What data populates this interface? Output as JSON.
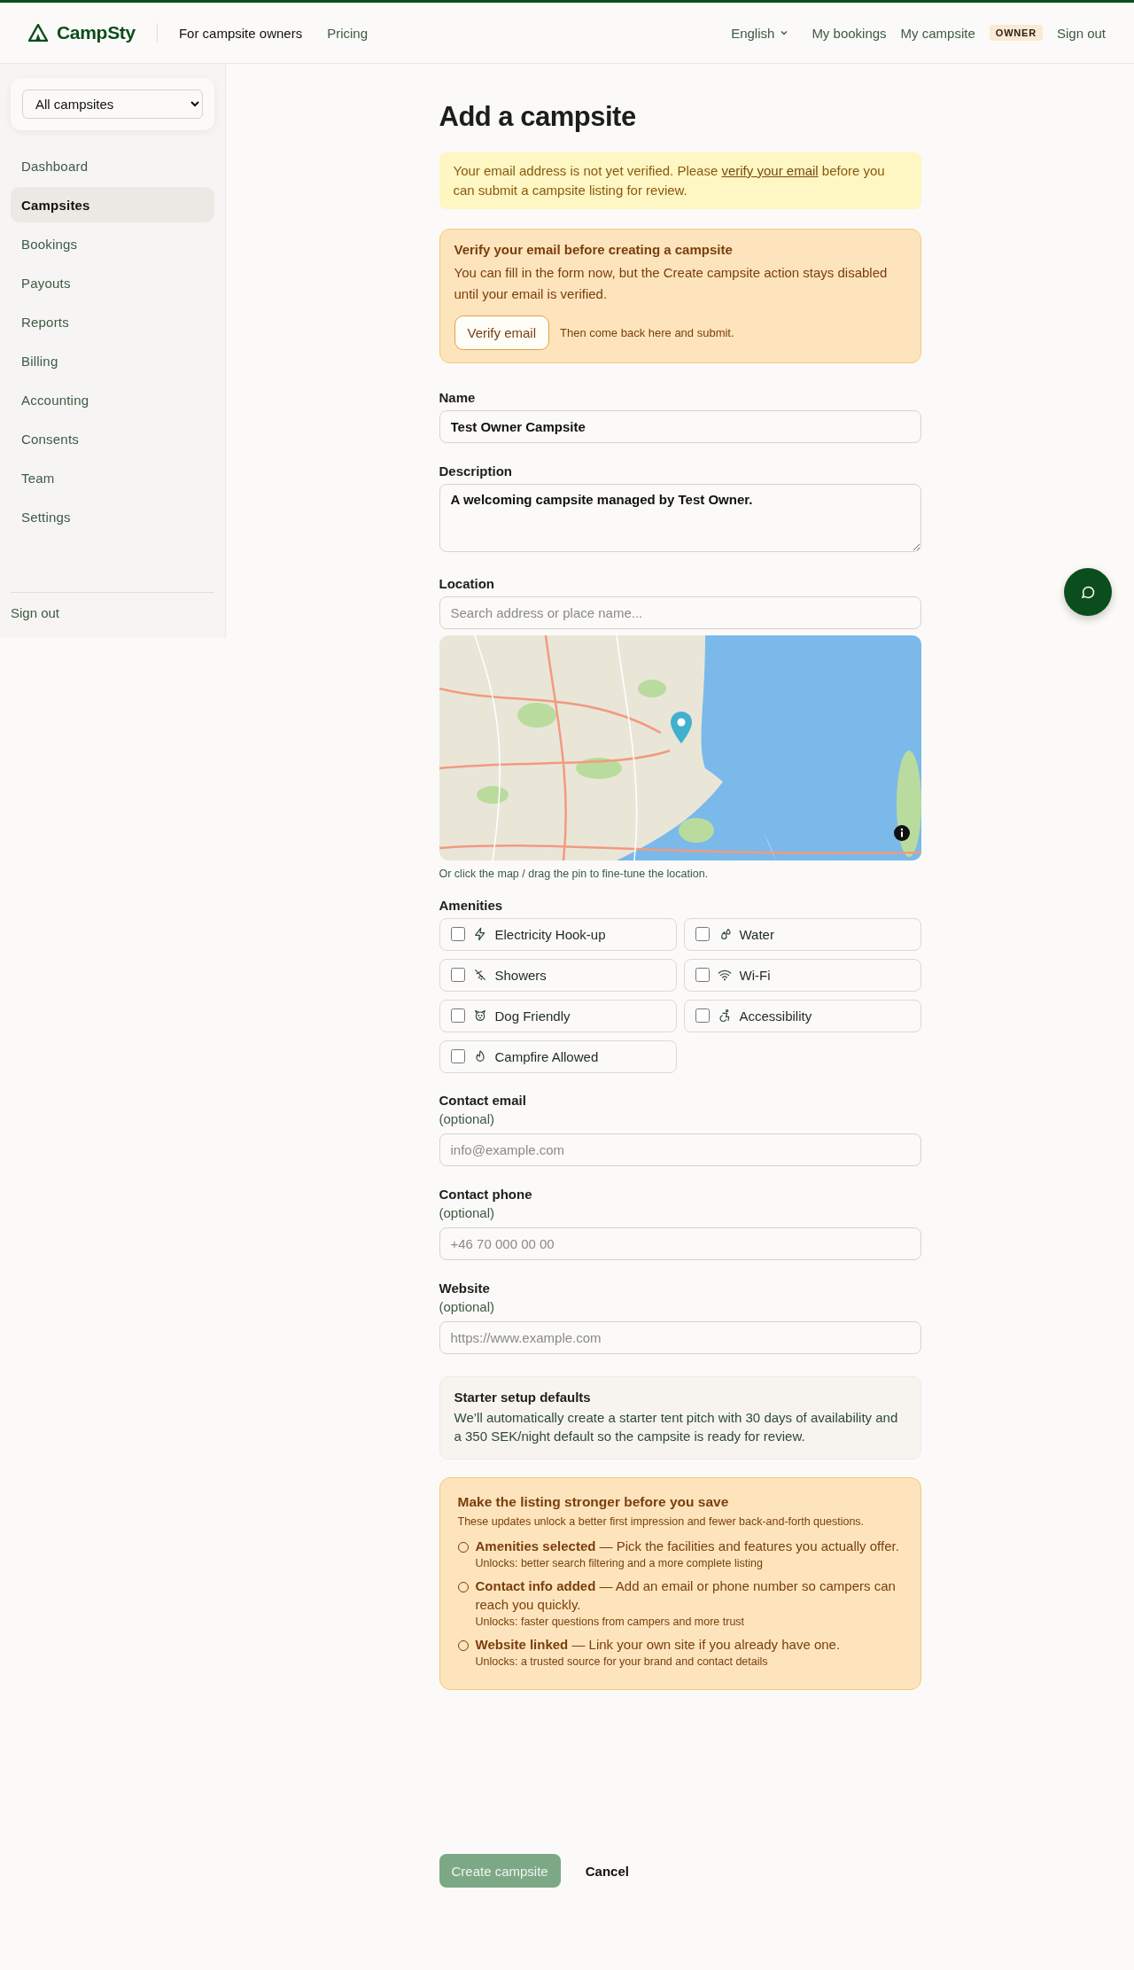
{
  "header": {
    "logo": "CampSty",
    "nav": [
      {
        "label": "For campsite owners",
        "selected": true
      },
      {
        "label": "Pricing",
        "selected": false
      }
    ],
    "language": "English",
    "links": [
      "My bookings",
      "My campsite"
    ],
    "role_badge": "OWNER",
    "sign_out": "Sign out"
  },
  "sidebar": {
    "campsite_select": "All campsites",
    "items": [
      {
        "label": "Dashboard",
        "selected": false
      },
      {
        "label": "Campsites",
        "selected": true
      },
      {
        "label": "Bookings",
        "selected": false
      },
      {
        "label": "Payouts",
        "selected": false
      },
      {
        "label": "Reports",
        "selected": false
      },
      {
        "label": "Billing",
        "selected": false
      },
      {
        "label": "Accounting",
        "selected": false
      },
      {
        "label": "Consents",
        "selected": false
      },
      {
        "label": "Team",
        "selected": false
      },
      {
        "label": "Settings",
        "selected": false
      }
    ],
    "sign_out": "Sign out"
  },
  "page": {
    "title": "Add a campsite"
  },
  "email_alert": {
    "text_before": "Your email address is not yet verified. Please ",
    "link": "verify your email",
    "text_after": " before you can submit a campsite listing for review."
  },
  "verify_notice": {
    "title": "Verify your email before creating a campsite",
    "body": "You can fill in the form now, but the Create campsite action stays disabled until your email is verified.",
    "button": "Verify email",
    "hint": "Then come back here and submit."
  },
  "form": {
    "name": {
      "label": "Name",
      "value": "Test Owner Campsite"
    },
    "description": {
      "label": "Description",
      "value": "A welcoming campsite managed by Test Owner."
    },
    "location": {
      "label": "Location",
      "placeholder": "Search address or place name...",
      "hint": "Or click the map / drag the pin to fine-tune the location."
    },
    "amenities": {
      "label": "Amenities",
      "items": [
        {
          "label": "Electricity Hook-up",
          "checked": false
        },
        {
          "label": "Water",
          "checked": false
        },
        {
          "label": "Showers",
          "checked": false
        },
        {
          "label": "Wi-Fi",
          "checked": false
        },
        {
          "label": "Dog Friendly",
          "checked": false
        },
        {
          "label": "Accessibility",
          "checked": false
        },
        {
          "label": "Campfire Allowed",
          "checked": false
        }
      ]
    },
    "contact_fields": [
      {
        "label": "Contact email",
        "note": "(optional)",
        "placeholder": "info@example.com"
      },
      {
        "label": "Contact phone",
        "note": "(optional)",
        "placeholder": "+46 70 000 00 00"
      },
      {
        "label": "Website",
        "note": "(optional)",
        "placeholder": "https://www.example.com"
      }
    ]
  },
  "starter_defaults": {
    "title": "Starter setup defaults",
    "body": "We’ll automatically create a starter tent pitch with 30 days of availability and a 350 SEK/night default so the campsite is ready for review."
  },
  "checklist": {
    "title": "Make the listing stronger before you save",
    "subtitle": "These updates unlock a better first impression and fewer back-and-forth questions.",
    "items": [
      {
        "text": "**Amenities selected** — Pick the facilities and features you actually offer.",
        "unlocks": "Unlocks: better search filtering and a more complete listing",
        "done": false
      },
      {
        "text": "**Contact info added** — Add an email or phone number so campers can reach you quickly.",
        "unlocks": "Unlocks: faster questions from campers and more trust",
        "done": false
      },
      {
        "text": "**Website linked** — Link your own site if you already have one.",
        "unlocks": "Unlocks: a trusted source for your brand and contact details",
        "done": false
      }
    ]
  },
  "actions": {
    "submit": {
      "label": "Create campsite",
      "disabled": true
    },
    "cancel": "Cancel"
  }
}
